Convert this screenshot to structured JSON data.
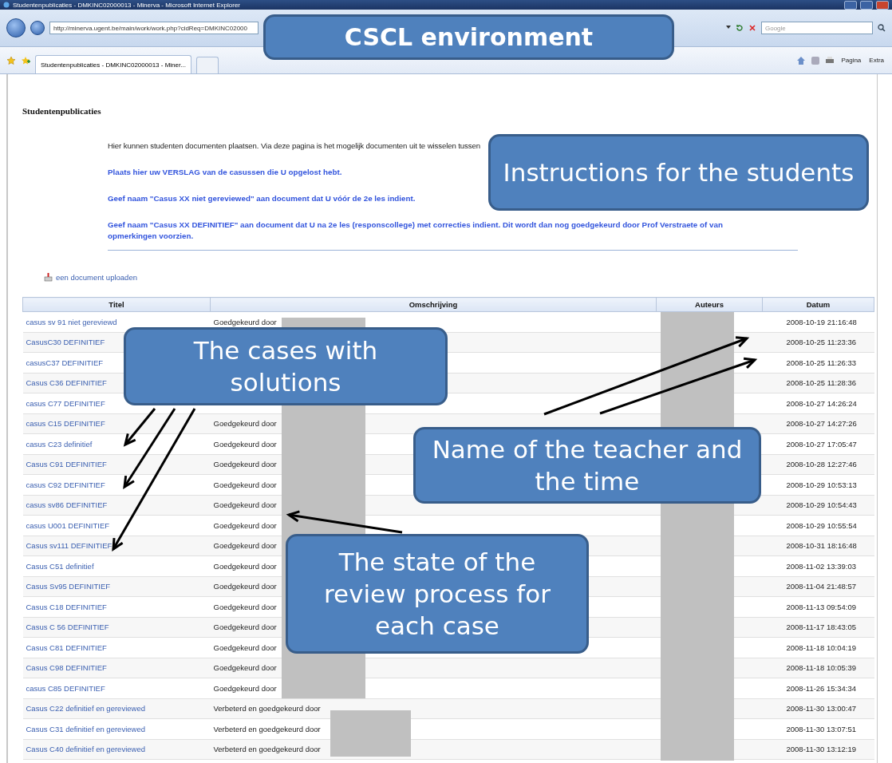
{
  "browser": {
    "title": "Studentenpublicaties - DMKINC02000013 - Minerva - Microsoft Internet Explorer",
    "address": "http://minerva.ugent.be/main/work/work.php?cidReq=DMKINC02000",
    "search_placeholder": "Google",
    "tab": "Studentenpublicaties - DMKINC02000013 - Miner...",
    "tools": [
      "Pagina",
      "Extra"
    ]
  },
  "page": {
    "heading": "Studentenpublicaties",
    "intro": "Hier kunnen studenten documenten plaatsen. Via deze pagina is het mogelijk documenten uit te wisselen tussen",
    "instructions": [
      "Plaats hier uw VERSLAG van de casussen die U opgelost hebt.",
      "Geef naam  \"Casus XX niet gereviewed\" aan document dat U vóór de 2e les indient.",
      "Geef naam \"Casus XX DEFINITIEF\" aan document dat U na 2e les (responscollege) met correcties indient. Dit wordt dan nog goedgekeurd door Prof Verstraete of van opmerkingen voorzien."
    ],
    "upload_link": "een document uploaden"
  },
  "table": {
    "columns": [
      "Titel",
      "Omschrijving",
      "Auteurs",
      "Datum"
    ],
    "rows": [
      {
        "title": "casus sv 91 niet gereviewd",
        "description": "Goedgekeurd door",
        "date": "2008-10-19 21:16:48"
      },
      {
        "title": "CasusC30 DEFINITIEF",
        "date": "2008-10-25 11:23:36"
      },
      {
        "title": "casusC37 DEFINITIEF",
        "date": "2008-10-25 11:26:33"
      },
      {
        "title": "Casus C36 DEFINITIEF",
        "date": "2008-10-25 11:28:36"
      },
      {
        "title": "casus C77 DEFINITIEF",
        "date": "2008-10-27 14:26:24"
      },
      {
        "title": "casus C15 DEFINITIEF",
        "description": "Goedgekeurd door",
        "date": "2008-10-27 14:27:26"
      },
      {
        "title": "casus C23 definitief",
        "description": "Goedgekeurd door",
        "date": "2008-10-27 17:05:47"
      },
      {
        "title": "Casus C91 DEFINITIEF",
        "description": "Goedgekeurd door",
        "date": "2008-10-28 12:27:46"
      },
      {
        "title": "casus C92 DEFINITIEF",
        "description": "Goedgekeurd door",
        "date": "2008-10-29 10:53:13"
      },
      {
        "title": "casus sv86 DEFINITIEF",
        "description": "Goedgekeurd door",
        "date": "2008-10-29 10:54:43"
      },
      {
        "title": "casus U001 DEFINITIEF",
        "description": "Goedgekeurd door",
        "date": "2008-10-29 10:55:54"
      },
      {
        "title": "Casus sv111 DEFINITIEF",
        "description": "Goedgekeurd door",
        "date": "2008-10-31 18:16:48"
      },
      {
        "title": "Casus C51 definitief",
        "description": "Goedgekeurd door",
        "date": "2008-11-02 13:39:03"
      },
      {
        "title": "Casus Sv95 DEFINITIEF",
        "description": "Goedgekeurd door",
        "date": "2008-11-04 21:48:57"
      },
      {
        "title": "Casus C18 DEFINITIEF",
        "description": "Goedgekeurd door",
        "date": "2008-11-13 09:54:09"
      },
      {
        "title": "Casus C 56 DEFINITIEF",
        "description": "Goedgekeurd door",
        "date": "2008-11-17 18:43:05"
      },
      {
        "title": "Casus C81 DEFINITIEF",
        "description": "Goedgekeurd door",
        "date": "2008-11-18 10:04:19"
      },
      {
        "title": "Casus C98 DEFINITIEF",
        "description": "Goedgekeurd door",
        "date": "2008-11-18 10:05:39"
      },
      {
        "title": "casus C85 DEFINITIEF",
        "description": "Goedgekeurd door",
        "date": "2008-11-26 15:34:34"
      },
      {
        "title": "Casus C22 definitief en gereviewed",
        "description": "Verbeterd en goedgekeurd door",
        "date": "2008-11-30 13:00:47"
      },
      {
        "title": "Casus C31 definitief en gereviewed",
        "description": "Verbeterd en goedgekeurd door",
        "date": "2008-11-30 13:07:51"
      },
      {
        "title": "Casus C40 definitief en gereviewed",
        "description": "Verbeterd en goedgekeurd door",
        "date": "2008-11-30 13:12:19"
      }
    ]
  },
  "callouts": [
    {
      "text": "CSCL environment"
    },
    {
      "text": "Instructions for the students"
    },
    {
      "text": "The cases with solutions"
    },
    {
      "text": "Name of the teacher and the time"
    },
    {
      "text": "The state of the review process for each case"
    }
  ]
}
